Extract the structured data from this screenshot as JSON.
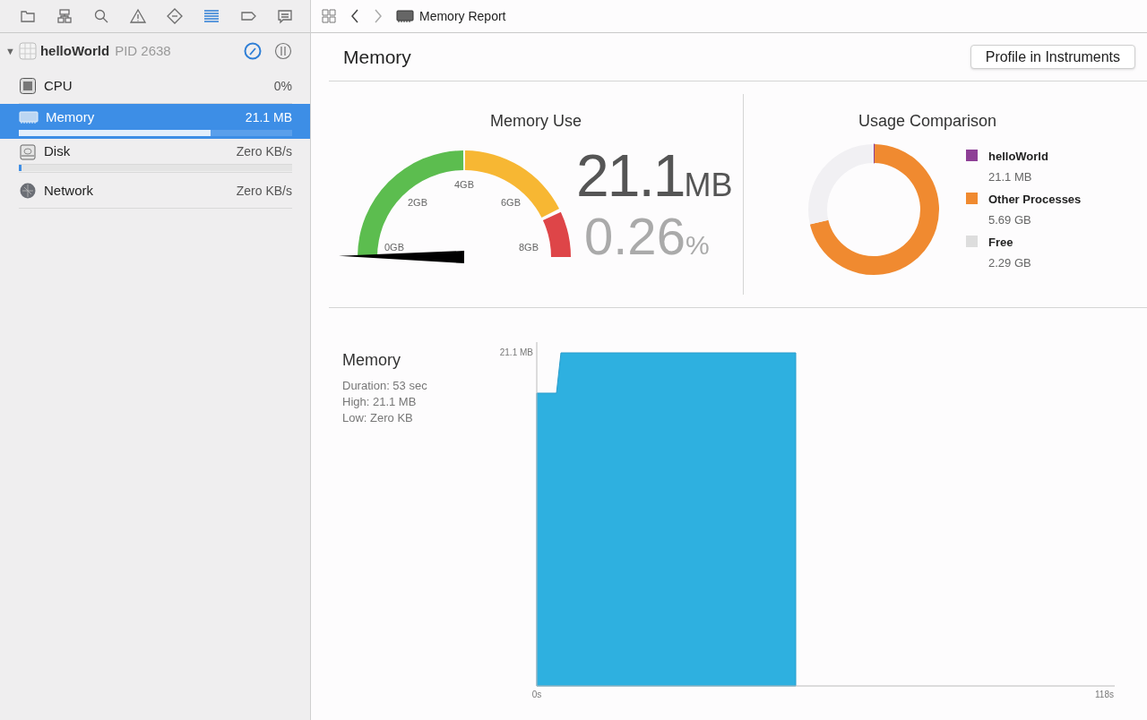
{
  "navigator_tabs": [
    {
      "kind": "folder",
      "selected": false
    },
    {
      "kind": "hierarchy",
      "selected": false
    },
    {
      "kind": "search",
      "selected": false
    },
    {
      "kind": "warning",
      "selected": false
    },
    {
      "kind": "breakpoint",
      "selected": false
    },
    {
      "kind": "debug",
      "selected": true
    },
    {
      "kind": "tag",
      "selected": false
    },
    {
      "kind": "report",
      "selected": false
    }
  ],
  "process": {
    "toggle": "▼",
    "name": "helloWorld",
    "pid": "PID 2638",
    "expanded": true
  },
  "gauges": [
    {
      "kind": "cpu",
      "name": "CPU",
      "value": "0%",
      "selected": false
    },
    {
      "kind": "memory",
      "name": "Memory",
      "value": "21.1 MB",
      "selected": true,
      "level": 0.7
    },
    {
      "kind": "disk",
      "name": "Disk",
      "value": "Zero KB/s",
      "selected": false,
      "level": 0.01
    },
    {
      "kind": "network",
      "name": "Network",
      "value": "Zero KB/s",
      "selected": false
    }
  ],
  "breadcrumb": "Memory Report",
  "title": "Memory",
  "profile_button": "Profile in Instruments",
  "memory_use": {
    "title": "Memory Use",
    "ticks": [
      "0GB",
      "2GB",
      "4GB",
      "6GB",
      "8GB"
    ],
    "level": 0.0026,
    "amount": "21.1",
    "amount_unit": "MB",
    "percent": "0.26",
    "percent_unit": "%"
  },
  "usage_comparison": {
    "title": "Usage Comparison",
    "legend": [
      {
        "value": "21.1 MB",
        "color": "#8e3f96"
      },
      {
        "value": "5.69 GB",
        "color": "#f08a30"
      },
      {
        "value": "2.29 GB",
        "color": "#dddddd"
      }
    ],
    "chart_data": {
      "type": "donut",
      "categories": [
        "helloWorld",
        "Other Processes",
        "Free"
      ],
      "values": [
        0.26,
        71.12,
        28.62
      ]
    }
  },
  "timeline": {
    "title": "Memory",
    "stats": [
      "Duration: 53 sec",
      "High: 21.1 MB",
      "Low: Zero KB"
    ],
    "y_label": "21.1 MB",
    "x_labels": [
      "0s",
      "118s"
    ]
  }
}
